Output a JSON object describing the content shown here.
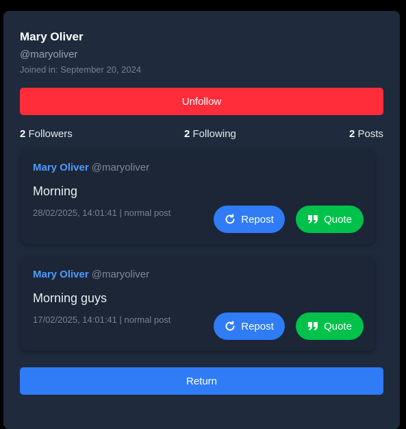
{
  "profile": {
    "name": "Mary Oliver",
    "handle": "@maryoliver",
    "joined": "Joined in: September 20, 2024"
  },
  "actions": {
    "unfollow_label": "Unfollow",
    "return_label": "Return"
  },
  "stats": {
    "followers_count": "2",
    "followers_label": "Followers",
    "following_count": "2",
    "following_label": "Following",
    "posts_count": "2",
    "posts_label": "Posts"
  },
  "posts": [
    {
      "author_name": "Mary Oliver",
      "author_handle": "@maryoliver",
      "text": "Morning",
      "meta": "28/02/2025, 14:01:41 | normal post",
      "repost_label": "Repost",
      "quote_label": "Quote"
    },
    {
      "author_name": "Mary Oliver",
      "author_handle": "@maryoliver",
      "text": "Morning guys",
      "meta": "17/02/2025, 14:01:41 | normal post",
      "repost_label": "Repost",
      "quote_label": "Quote"
    }
  ],
  "icons": {
    "repost": "repost-icon",
    "quote": "quote-icon"
  },
  "colors": {
    "background": "#000000",
    "card": "#1f2a3c",
    "post_card": "#1c2637",
    "unfollow": "#ff2d3a",
    "primary": "#2f7cf6",
    "quote": "#00c24b",
    "author": "#4d9cff"
  }
}
